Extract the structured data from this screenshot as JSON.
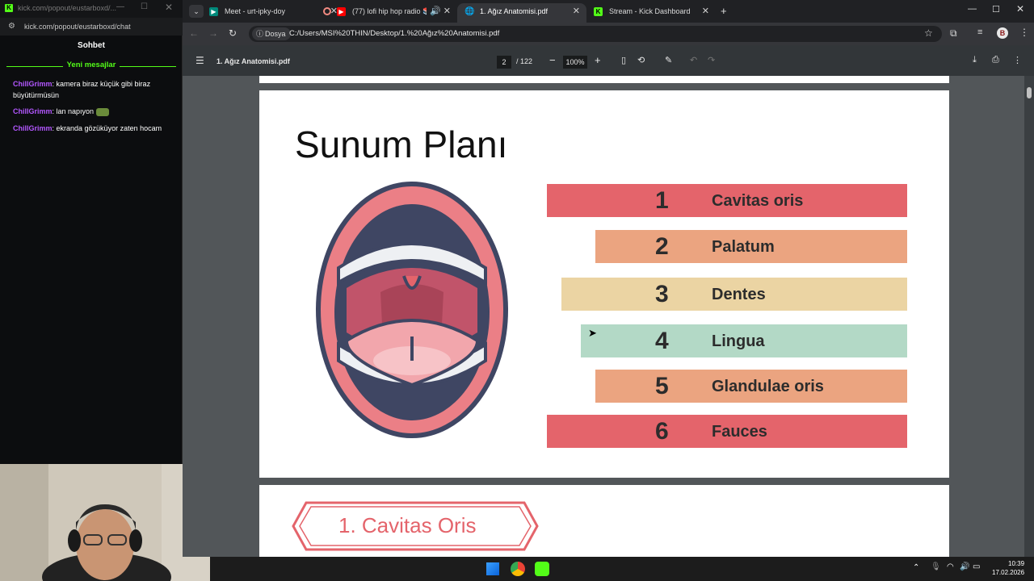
{
  "chat_popout": {
    "window_title": "kick.com/popout/eustarboxd/...",
    "url": "kick.com/popout/eustarboxd/chat",
    "header": "Sohbet",
    "new_messages_label": "Yeni mesajlar",
    "messages": [
      {
        "user": "ChillGrimm",
        "text": ": kamera biraz küçük gibi biraz büyütürmüsün"
      },
      {
        "user": "ChillGrimm",
        "text": ": lan napıyon"
      },
      {
        "user": "ChillGrimm",
        "text": ": ekranda gözüküyor zaten hocam"
      }
    ]
  },
  "browser": {
    "tabs": [
      {
        "label": "Meet - urt-ipky-doy",
        "icon": "google-meet-icon"
      },
      {
        "label": "(77) lofi hip hop radio 📚 b",
        "icon": "youtube-icon"
      },
      {
        "label": "1. Ağız Anatomisi.pdf",
        "icon": "globe-icon"
      },
      {
        "label": "Stream - Kick Dashboard",
        "icon": "kick-icon"
      }
    ],
    "address_chip": "Dosya",
    "address": "C:/Users/MSI%20THIN/Desktop/1.%20Ağız%20Anatomisi.pdf",
    "profile_initial": "B"
  },
  "pdf": {
    "filename": "1. Ağız Anatomisi.pdf",
    "current_page": "2",
    "total_pages": "/ 122",
    "zoom": "100%"
  },
  "slide": {
    "title": "Sunum Planı",
    "items": [
      {
        "num": "1",
        "label": "Cavitas oris",
        "color": "#e4646b"
      },
      {
        "num": "2",
        "label": "Palatum",
        "color": "#eba480"
      },
      {
        "num": "3",
        "label": "Dentes",
        "color": "#ebd4a3"
      },
      {
        "num": "4",
        "label": "Lingua",
        "color": "#b3d9c6"
      },
      {
        "num": "5",
        "label": "Glandulae oris",
        "color": "#eba480"
      },
      {
        "num": "6",
        "label": "Fauces",
        "color": "#e4646b"
      }
    ],
    "next_slide_heading": "1. Cavitas Oris"
  },
  "taskbar": {
    "time": "10:39",
    "date": "17.02.2026"
  }
}
